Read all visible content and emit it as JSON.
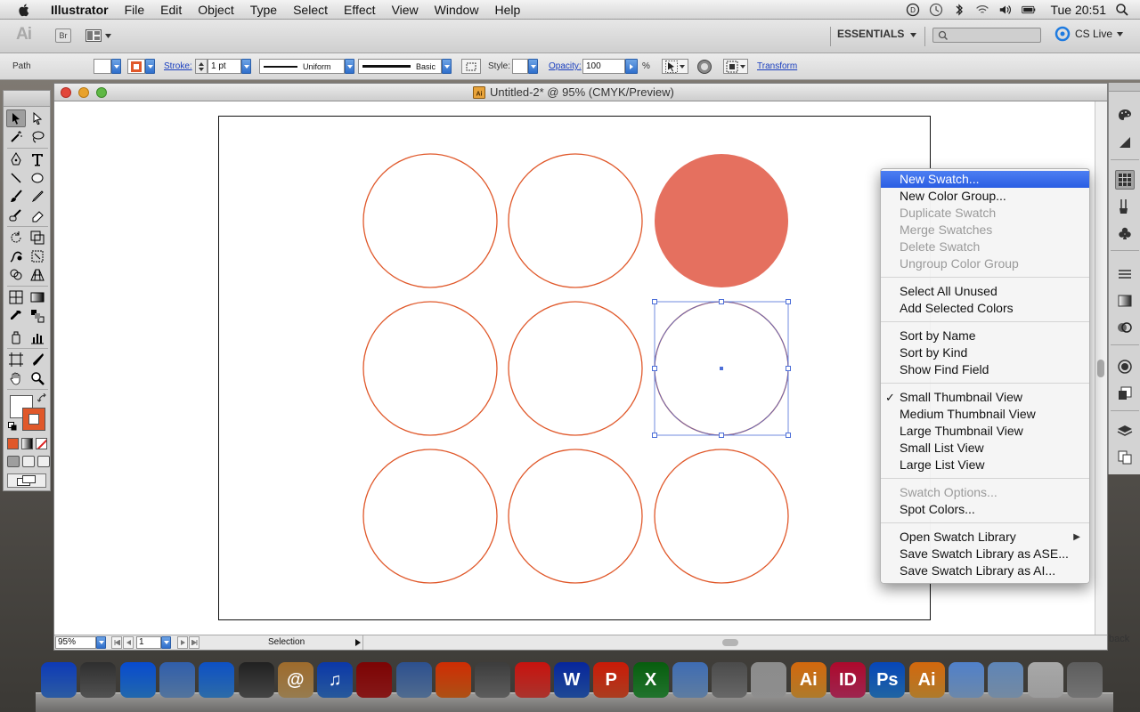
{
  "menubar": {
    "app_name": "Illustrator",
    "items": [
      "File",
      "Edit",
      "Object",
      "Type",
      "Select",
      "Effect",
      "View",
      "Window",
      "Help"
    ],
    "clock": "Tue 20:51"
  },
  "appbar": {
    "bridge_label": "Br",
    "workspace": "ESSENTIALS",
    "search_placeholder": "",
    "cs_live": "CS Live"
  },
  "controlbar": {
    "selection_type": "Path",
    "stroke_label": "Stroke:",
    "stroke_weight": "1 pt",
    "stroke_profile": "Uniform",
    "brush": "Basic",
    "style_label": "Style:",
    "opacity_label": "Opacity:",
    "opacity_value": "100",
    "opacity_unit": "%",
    "transform_label": "Transform",
    "fill_color": "#ffffff",
    "stroke_color": "#e0582a"
  },
  "document": {
    "title": "Untitled-2* @ 95% (CMYK/Preview)",
    "zoom": "95%",
    "page": "1",
    "status": "Selection",
    "circle_stroke": "#e0582a",
    "filled_circle_color": "#e5705f",
    "selection_color": "#4d6fd8"
  },
  "flyout": {
    "items": [
      {
        "label": "New Swatch...",
        "state": "highlight"
      },
      {
        "label": "New Color Group...",
        "state": "enabled"
      },
      {
        "label": "Duplicate Swatch",
        "state": "disabled"
      },
      {
        "label": "Merge Swatches",
        "state": "disabled"
      },
      {
        "label": "Delete Swatch",
        "state": "disabled"
      },
      {
        "label": "Ungroup Color Group",
        "state": "disabled"
      },
      {
        "label": "Select All Unused",
        "state": "enabled"
      },
      {
        "label": "Add Selected Colors",
        "state": "enabled"
      },
      {
        "label": "Sort by Name",
        "state": "enabled"
      },
      {
        "label": "Sort by Kind",
        "state": "enabled"
      },
      {
        "label": "Show Find Field",
        "state": "enabled"
      },
      {
        "label": "Small Thumbnail View",
        "state": "checked"
      },
      {
        "label": "Medium Thumbnail View",
        "state": "enabled"
      },
      {
        "label": "Large Thumbnail View",
        "state": "enabled"
      },
      {
        "label": "Small List View",
        "state": "enabled"
      },
      {
        "label": "Large List View",
        "state": "enabled"
      },
      {
        "label": "Swatch Options...",
        "state": "disabled"
      },
      {
        "label": "Spot Colors...",
        "state": "enabled"
      },
      {
        "label": "Open Swatch Library",
        "state": "submenu"
      },
      {
        "label": "Save Swatch Library as ASE...",
        "state": "enabled"
      },
      {
        "label": "Save Swatch Library as AI...",
        "state": "enabled"
      }
    ]
  },
  "panel_tab_fragment": "back",
  "dock_apps": [
    {
      "name": "finder",
      "color": "#3b7ad8",
      "glyph": ""
    },
    {
      "name": "launchpad",
      "color": "#6d6d6d",
      "glyph": ""
    },
    {
      "name": "app-store",
      "color": "#2d8ae6",
      "glyph": ""
    },
    {
      "name": "mail",
      "color": "#6f9bd1",
      "glyph": ""
    },
    {
      "name": "safari",
      "color": "#3b8fe0",
      "glyph": ""
    },
    {
      "name": "facetime",
      "color": "#5b5b5b",
      "glyph": ""
    },
    {
      "name": "address-book",
      "color": "#c9a56a",
      "glyph": "@"
    },
    {
      "name": "itunes",
      "color": "#3577cf",
      "glyph": "♫"
    },
    {
      "name": "photo-booth",
      "color": "#b22020",
      "glyph": ""
    },
    {
      "name": "iphoto",
      "color": "#6b8fbf",
      "glyph": ""
    },
    {
      "name": "firefox",
      "color": "#e66b1d",
      "glyph": ""
    },
    {
      "name": "system-preferences",
      "color": "#7c7c7c",
      "glyph": ""
    },
    {
      "name": "chrome",
      "color": "#e2453c",
      "glyph": ""
    },
    {
      "name": "word",
      "color": "#2a62c7",
      "glyph": "W"
    },
    {
      "name": "powerpoint",
      "color": "#e3522b",
      "glyph": "P"
    },
    {
      "name": "excel",
      "color": "#2c9a3c",
      "glyph": "X"
    },
    {
      "name": "preview",
      "color": "#7ea6d6",
      "glyph": ""
    },
    {
      "name": "image-capture",
      "color": "#8a8a8a",
      "glyph": ""
    },
    {
      "name": "solution-menu",
      "color": "#bdbdbd",
      "glyph": ""
    },
    {
      "name": "illustrator",
      "color": "#e8a33a",
      "glyph": "Ai"
    },
    {
      "name": "indesign",
      "color": "#d2316a",
      "glyph": "ID"
    },
    {
      "name": "photoshop",
      "color": "#2b86d9",
      "glyph": "Ps"
    },
    {
      "name": "illustrator-2",
      "color": "#e8a33a",
      "glyph": "Ai"
    },
    {
      "name": "folder",
      "color": "#8fb5e3",
      "glyph": ""
    },
    {
      "name": "downloads",
      "color": "#9bb8d8",
      "glyph": ""
    },
    {
      "name": "documents",
      "color": "#cfcfcf",
      "glyph": ""
    },
    {
      "name": "trash",
      "color": "#9a9a9a",
      "glyph": ""
    }
  ]
}
